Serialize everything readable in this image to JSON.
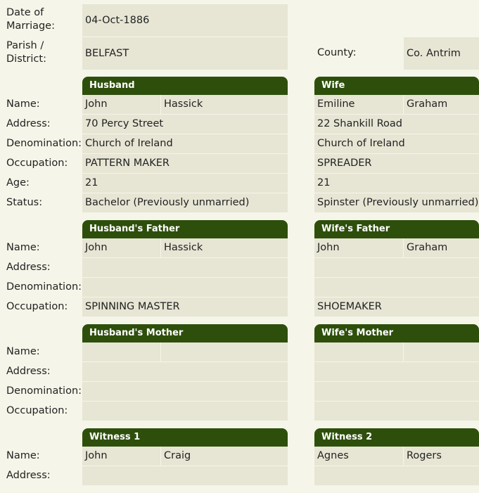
{
  "marriage": {
    "date_label": "Date of Marriage:",
    "date_value": "04-Oct-1886",
    "parish_label": "Parish / District:",
    "parish_value": "BELFAST",
    "county_label": "County:",
    "county_value": "Co. Antrim"
  },
  "labels": {
    "name": "Name:",
    "address": "Address:",
    "denomination": "Denomination:",
    "occupation": "Occupation:",
    "age": "Age:",
    "status": "Status:"
  },
  "husband": {
    "title": "Husband",
    "first": "John",
    "last": "Hassick",
    "address": "70 Percy Street",
    "denomination": "Church of Ireland",
    "occupation": "PATTERN MAKER",
    "age": "21",
    "status": "Bachelor (Previously unmarried)"
  },
  "wife": {
    "title": "Wife",
    "first": "Emiline",
    "last": "Graham",
    "address": "22 Shankill Road",
    "denomination": "Church of Ireland",
    "occupation": "SPREADER",
    "age": "21",
    "status": "Spinster (Previously unmarried)"
  },
  "husband_father": {
    "title": "Husband's Father",
    "first": "John",
    "last": "Hassick",
    "address": "",
    "denomination": "",
    "occupation": "SPINNING MASTER"
  },
  "wife_father": {
    "title": "Wife's Father",
    "first": "John",
    "last": "Graham",
    "address": "",
    "denomination": "",
    "occupation": "SHOEMAKER"
  },
  "husband_mother": {
    "title": "Husband's Mother",
    "first": "",
    "last": "",
    "address": "",
    "denomination": "",
    "occupation": ""
  },
  "wife_mother": {
    "title": "Wife's Mother",
    "first": "",
    "last": "",
    "address": "",
    "denomination": "",
    "occupation": ""
  },
  "witness1": {
    "title": "Witness 1",
    "first": "John",
    "last": "Craig",
    "address": ""
  },
  "witness2": {
    "title": "Witness 2",
    "first": "Agnes",
    "last": "Rogers",
    "address": ""
  }
}
